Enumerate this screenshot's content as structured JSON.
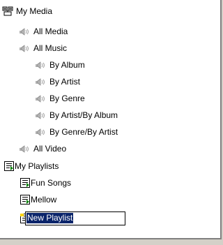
{
  "tree": {
    "root": {
      "label": "My Media",
      "icon": "media-library-icon"
    },
    "items": [
      {
        "id": "all-media",
        "label": "All Media",
        "icon": "speaker-icon"
      },
      {
        "id": "all-music",
        "label": "All Music",
        "icon": "speaker-icon"
      },
      {
        "id": "by-album",
        "label": "By Album",
        "icon": "speaker-icon"
      },
      {
        "id": "by-artist",
        "label": "By Artist",
        "icon": "speaker-icon"
      },
      {
        "id": "by-genre",
        "label": "By Genre",
        "icon": "speaker-icon"
      },
      {
        "id": "by-artist-by-album",
        "label": "By Artist/By Album",
        "icon": "speaker-icon"
      },
      {
        "id": "by-genre-by-artist",
        "label": "By Genre/By Artist",
        "icon": "speaker-icon"
      },
      {
        "id": "all-video",
        "label": "All Video",
        "icon": "speaker-icon"
      }
    ],
    "playlists": {
      "label": "My Playlists",
      "icon": "playlist-icon",
      "items": [
        {
          "id": "fun-songs",
          "label": "Fun Songs",
          "icon": "playlist-icon"
        },
        {
          "id": "mellow",
          "label": "Mellow",
          "icon": "playlist-icon"
        }
      ],
      "editing": {
        "value": "New Playlist",
        "icon": "new-playlist-icon"
      }
    }
  },
  "colors": {
    "selection_bg": "#0a246a",
    "selection_text": "#ffffff",
    "playlist_green": "#008000",
    "icon_gray": "#9a9a9a"
  }
}
